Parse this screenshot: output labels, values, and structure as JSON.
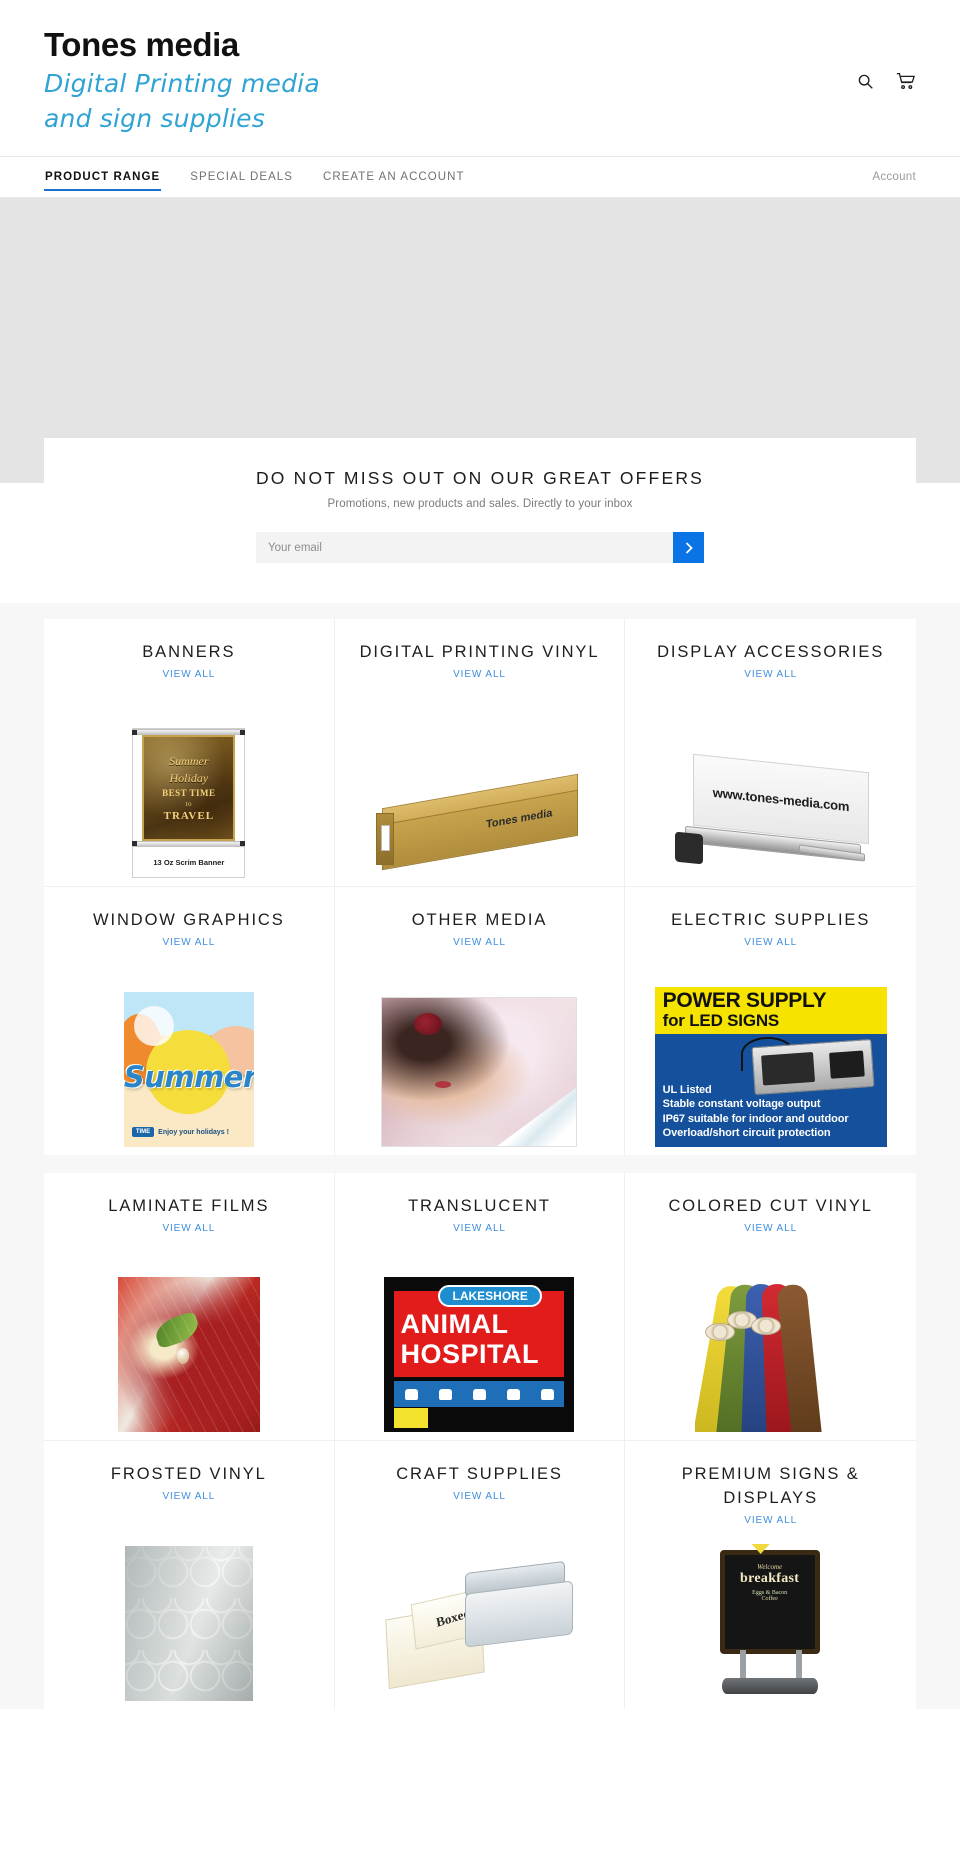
{
  "header": {
    "logo_main": "Tones media",
    "logo_sub_line1": "Digital Printing media",
    "logo_sub_line2": "and sign supplies",
    "search_icon": "search-icon",
    "cart_icon": "shopping-cart-icon"
  },
  "nav": {
    "items": [
      {
        "label": "PRODUCT RANGE",
        "active": true
      },
      {
        "label": "SPECIAL DEALS",
        "active": false
      },
      {
        "label": "CREATE AN ACCOUNT",
        "active": false
      }
    ],
    "account_label": "Account",
    "active_underline_color": "#1f6fd0"
  },
  "newsletter": {
    "title": "DO NOT MISS OUT ON OUR GREAT OFFERS",
    "subtitle": "Promotions, new products and sales. Directly to your inbox",
    "email_placeholder": "Your email",
    "email_value": "",
    "submit_icon": "chevron-right-icon",
    "submit_color": "#0a74e6"
  },
  "categories": {
    "view_all_label": "VIEW ALL",
    "link_color": "#3e8ede",
    "row1": [
      {
        "title": "BANNERS",
        "art": "banner-stand"
      },
      {
        "title": "DIGITAL PRINTING VINYL",
        "art": "roll-box"
      },
      {
        "title": "DISPLAY ACCESSORIES",
        "art": "rollup-banner"
      }
    ],
    "row2": [
      {
        "title": "WINDOW GRAPHICS",
        "art": "summer-window-graphic"
      },
      {
        "title": "OTHER MEDIA",
        "art": "model-photo-media"
      },
      {
        "title": "ELECTRIC SUPPLIES",
        "art": "power-supply-flyer"
      }
    ],
    "row3": [
      {
        "title": "LAMINATE FILMS",
        "art": "apple-macro"
      },
      {
        "title": "TRANSLUCENT",
        "art": "animal-hospital-sign"
      },
      {
        "title": "COLORED CUT VINYL",
        "art": "colored-rolls"
      }
    ],
    "row4": [
      {
        "title": "FROSTED VINYL",
        "art": "frosted-pattern"
      },
      {
        "title": "CRAFT SUPPLIES",
        "art": "craft-plotter"
      },
      {
        "title": "PREMIUM SIGNS & DISPLAYS",
        "art": "a-frame-chalkboard"
      }
    ]
  },
  "artwork_text": {
    "banner_poster": {
      "line1": "Summer",
      "line2": "Holiday",
      "line3": "BEST TIME",
      "line4": "to",
      "line5": "TRAVEL",
      "caption": "13 Oz Scrim Banner"
    },
    "roll_box_brand": "Tones media",
    "rollup_url": "www.tones-media.com",
    "summer_word": "Summer",
    "summer_pill": "TIME",
    "summer_tag": "Enjoy your holidays !",
    "power_supply": {
      "title_line1": "POWER SUPPLY",
      "title_line2": "for LED SIGNS",
      "bullet1": "UL Listed",
      "bullet2": "Stable constant voltage output",
      "bullet3": "IP67 suitable for indoor and outdoor",
      "bullet4": "Overload/short circuit protection"
    },
    "translucent_sign": {
      "pill": "LAKESHORE",
      "line1": "ANIMAL",
      "line2": "HOSPITAL"
    }
  }
}
